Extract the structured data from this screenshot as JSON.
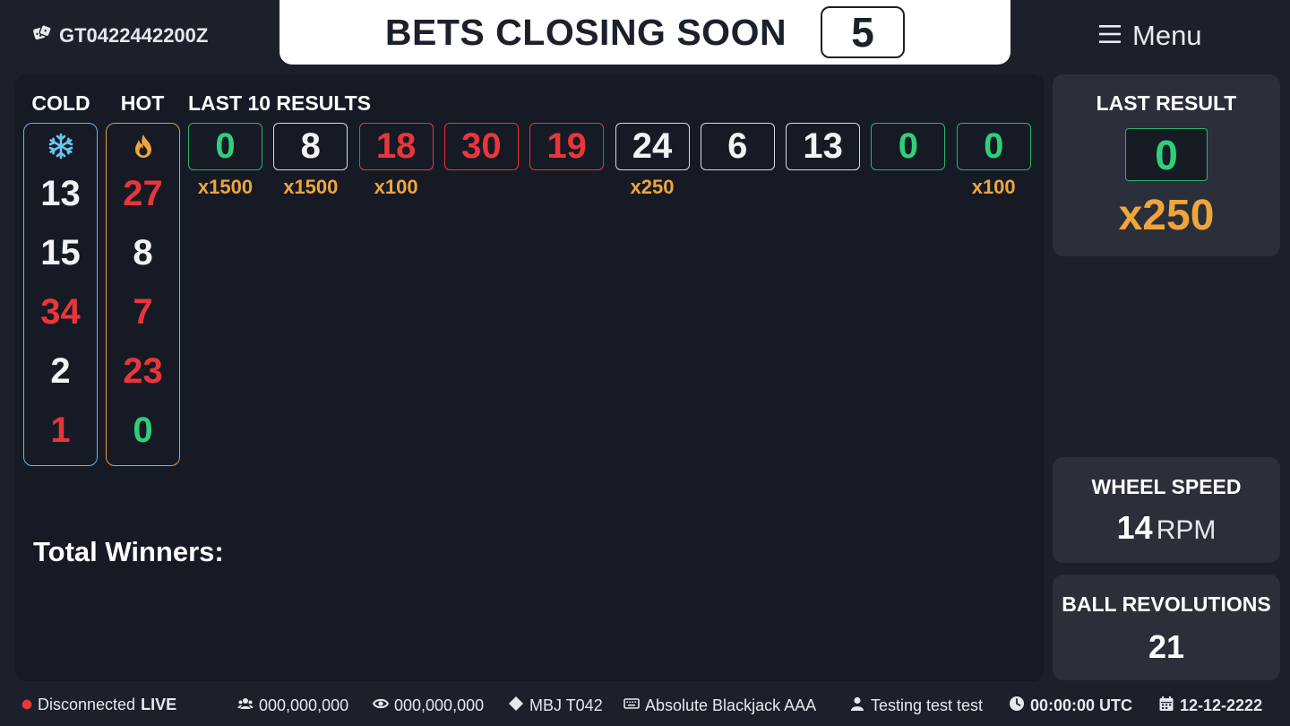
{
  "header": {
    "game_id": "GT0422442200Z",
    "banner_text": "BETS CLOSING SOON",
    "countdown": "5",
    "menu_label": "Menu"
  },
  "columns": {
    "cold_label": "COLD",
    "hot_label": "HOT",
    "last10_label": "LAST 10 RESULTS"
  },
  "cold": [
    {
      "value": "13",
      "color": "#f2f3f5"
    },
    {
      "value": "15",
      "color": "#f2f3f5"
    },
    {
      "value": "34",
      "color": "#e8363a"
    },
    {
      "value": "2",
      "color": "#f2f3f5"
    },
    {
      "value": "1",
      "color": "#e8363a"
    }
  ],
  "hot": [
    {
      "value": "27",
      "color": "#e8363a"
    },
    {
      "value": "8",
      "color": "#f2f3f5"
    },
    {
      "value": "7",
      "color": "#e8363a"
    },
    {
      "value": "23",
      "color": "#e8363a"
    },
    {
      "value": "0",
      "color": "#2fd07a"
    }
  ],
  "last_results": [
    {
      "value": "0",
      "color": "green",
      "mult": "x1500"
    },
    {
      "value": "8",
      "color": "black",
      "mult": "x1500"
    },
    {
      "value": "18",
      "color": "red",
      "mult": "x100"
    },
    {
      "value": "30",
      "color": "red",
      "mult": ""
    },
    {
      "value": "19",
      "color": "red",
      "mult": ""
    },
    {
      "value": "24",
      "color": "black",
      "mult": "x250"
    },
    {
      "value": "6",
      "color": "black",
      "mult": ""
    },
    {
      "value": "13",
      "color": "black",
      "mult": ""
    },
    {
      "value": "0",
      "color": "green",
      "mult": ""
    },
    {
      "value": "0",
      "color": "green",
      "mult": "x100"
    }
  ],
  "total_winners_label": "Total Winners:",
  "last_result": {
    "title": "LAST RESULT",
    "value": "0",
    "multiplier": "x250"
  },
  "wheel_speed": {
    "title": "WHEEL SPEED",
    "value": "14",
    "unit": "RPM"
  },
  "ball_revolutions": {
    "title": "BALL REVOLUTIONS",
    "value": "21"
  },
  "footer": {
    "status": "Disconnected",
    "live": "LIVE",
    "players": "000,000,000",
    "viewers": "000,000,000",
    "table_code": "MBJ T042",
    "table_name": "Absolute Blackjack AAA",
    "user": "Testing test test",
    "time": "00:00:00 UTC",
    "date": "12-12-2222"
  },
  "colors": {
    "red": "#e8363a",
    "green": "#2fd07a",
    "gold": "#f0a53a",
    "cold_border": "#6cb3e6",
    "hot_border": "#e8954a"
  },
  "icons": {
    "game_id": "dice-icon",
    "menu": "hamburger-icon",
    "cold": "snowflake-icon",
    "hot": "flame-icon",
    "status": "status-dot-icon",
    "players": "users-icon",
    "viewers": "eye-icon",
    "table_code": "diamond-icon",
    "table_name": "keyboard-icon",
    "user": "user-icon",
    "time": "clock-icon",
    "date": "calendar-icon"
  }
}
